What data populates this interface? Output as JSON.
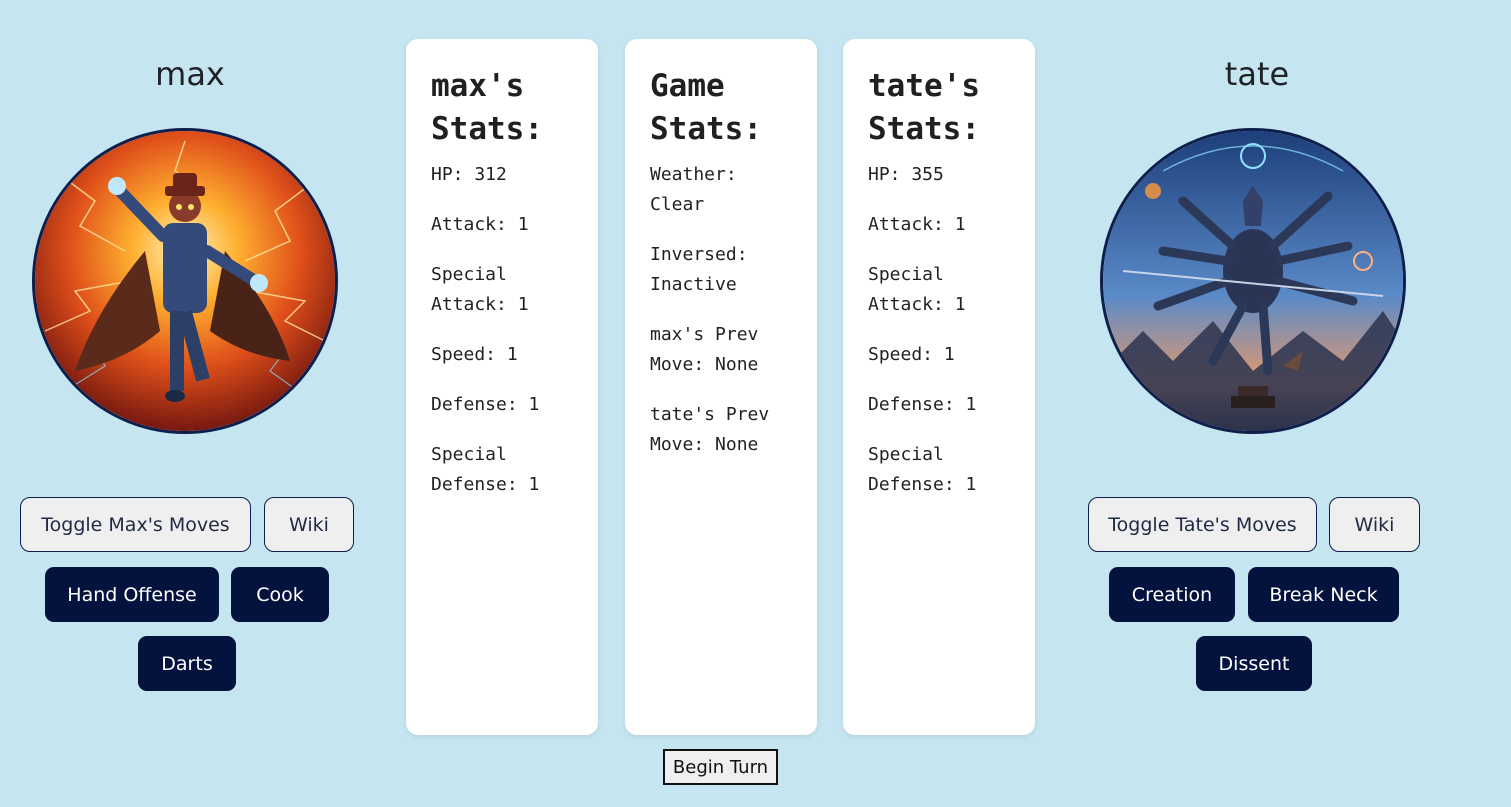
{
  "left_player": {
    "name": "max",
    "avatar_icon": "fire-lightning-mage-portrait",
    "toggle_label": "Toggle Max's Moves",
    "wiki_label": "Wiki",
    "moves": [
      "Hand Offense",
      "Cook",
      "Darts"
    ]
  },
  "right_player": {
    "name": "tate",
    "avatar_icon": "multi-armed-mech-portrait",
    "toggle_label": "Toggle Tate's Moves",
    "wiki_label": "Wiki",
    "moves": [
      "Creation",
      "Break Neck",
      "Dissent"
    ]
  },
  "max_stats": {
    "title": "max's Stats:",
    "lines": [
      "HP: 312",
      "Attack: 1",
      "Special Attack: 1",
      "Speed: 1",
      "Defense: 1",
      "Special Defense: 1"
    ]
  },
  "game_stats": {
    "title": "Game Stats:",
    "lines": [
      "Weather: Clear",
      "Inversed: Inactive",
      "max's Prev Move: None",
      "tate's Prev Move: None"
    ]
  },
  "tate_stats": {
    "title": "tate's Stats:",
    "lines": [
      "HP: 355",
      "Attack: 1",
      "Special Attack: 1",
      "Speed: 1",
      "Defense: 1",
      "Special Defense: 1"
    ]
  },
  "begin_turn_label": "Begin Turn",
  "colors": {
    "background": "#c5e5f0",
    "move_button": "#04123e",
    "card": "#ffffff"
  }
}
